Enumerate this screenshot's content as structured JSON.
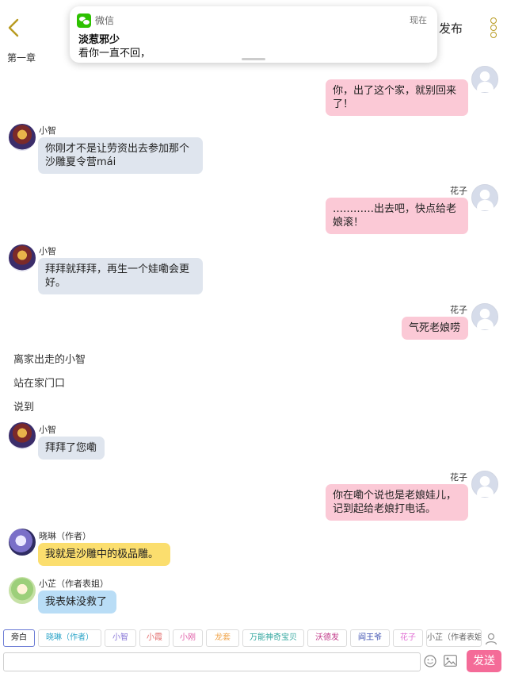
{
  "header": {
    "publish_label": "发布",
    "chapter_label": "第一章"
  },
  "notification": {
    "app": "微信",
    "time": "现在",
    "title": "淡惹邪少",
    "body": "看你一直不回，"
  },
  "messages": [
    {
      "speaker": "花子",
      "text": "你，出了这个家，就别回来了！"
    },
    {
      "speaker": "小智",
      "text": "你刚才不是让劳资出去参加那个沙雕夏令营mái"
    },
    {
      "speaker": "花子",
      "text": "…………出去吧，快点给老娘滚！"
    },
    {
      "speaker": "小智",
      "text": "拜拜就拜拜，再生一个娃嘞会更好。"
    },
    {
      "speaker": "花子",
      "text": "气死老娘唠"
    },
    {
      "narration": "离家出走的小智"
    },
    {
      "narration": "站在家门口"
    },
    {
      "narration": "说到"
    },
    {
      "speaker": "小智",
      "text": "拜拜了您嘞"
    },
    {
      "speaker": "花子",
      "text": "你在嘞个说也是老娘娃儿，记到起给老娘打电话。"
    },
    {
      "speaker": "晓琳（作者）",
      "text": "我就是沙雕中的极品雕。"
    },
    {
      "speaker": "小芷（作者表姐）",
      "text": "我表妹没救了"
    }
  ],
  "characters": [
    {
      "label": "旁白",
      "color": "#222222"
    },
    {
      "label": "晓琳（作者）",
      "color": "#2aa4c8"
    },
    {
      "label": "小智",
      "color": "#8a78d8"
    },
    {
      "label": "小霞",
      "color": "#e26a6a"
    },
    {
      "label": "小刚",
      "color": "#e05fa8"
    },
    {
      "label": "龙套",
      "color": "#f0a44a"
    },
    {
      "label": "万能神奇宝贝",
      "color": "#35a8a0"
    },
    {
      "label": "沃德发",
      "color": "#c23b8a"
    },
    {
      "label": "阎王爷",
      "color": "#3c4fb0"
    },
    {
      "label": "花子",
      "color": "#e06fd3"
    },
    {
      "label": "小芷（作者表姐）",
      "color": "#666666"
    }
  ],
  "composer": {
    "input_value": "",
    "send_label": "发送"
  },
  "colors": {
    "accent": "#f46b98",
    "pink_bubble": "#fbc9d6",
    "gray_bubble": "#dfe5ee",
    "author_bubble": "#fbde6e",
    "cousin_bubble": "#b9ddf6"
  }
}
